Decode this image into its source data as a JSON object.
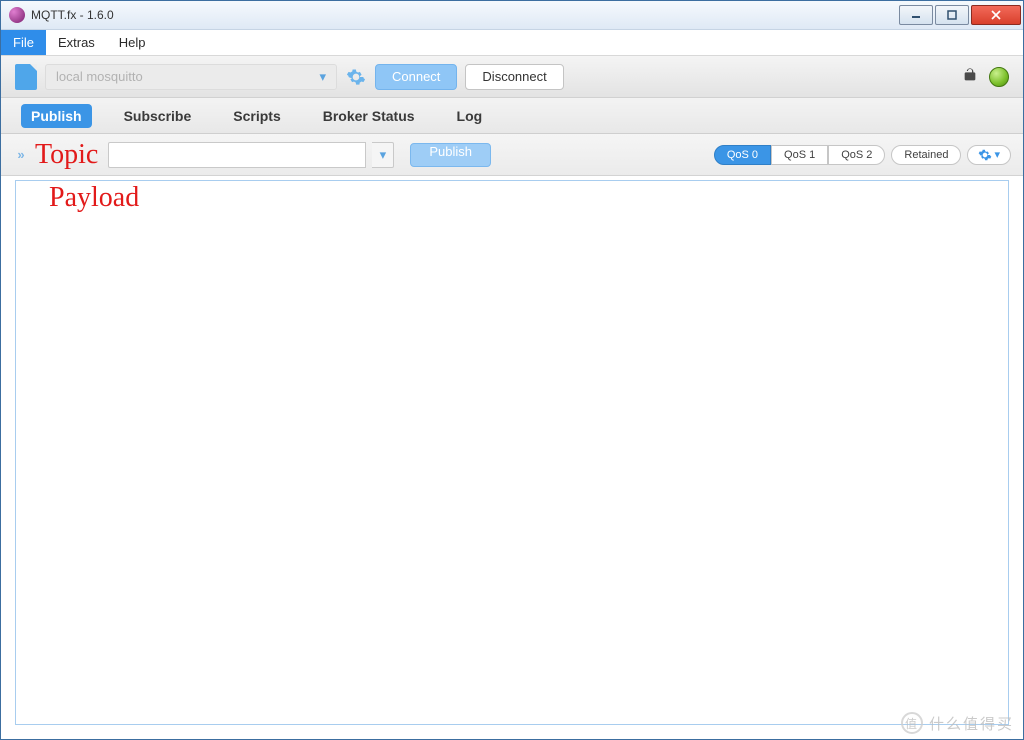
{
  "window_title": "MQTT.fx - 1.6.0",
  "menu": {
    "items": [
      "File",
      "Extras",
      "Help"
    ],
    "active_index": 0
  },
  "connection": {
    "profile_name": "local mosquitto",
    "connect_label": "Connect",
    "disconnect_label": "Disconnect",
    "locked": false,
    "status_color": "#7abf2a"
  },
  "tabs": {
    "items": [
      "Publish",
      "Subscribe",
      "Scripts",
      "Broker Status",
      "Log"
    ],
    "active_index": 0
  },
  "publish": {
    "topic_annot": "Topic",
    "topic_value": "",
    "publish_btn": "Publish",
    "qos": {
      "options": [
        "QoS 0",
        "QoS 1",
        "QoS 2"
      ],
      "active_index": 0
    },
    "retained_label": "Retained",
    "retained_active": false,
    "payload_annot": "Payload",
    "payload_value": ""
  },
  "watermark_text": "什么值得买"
}
